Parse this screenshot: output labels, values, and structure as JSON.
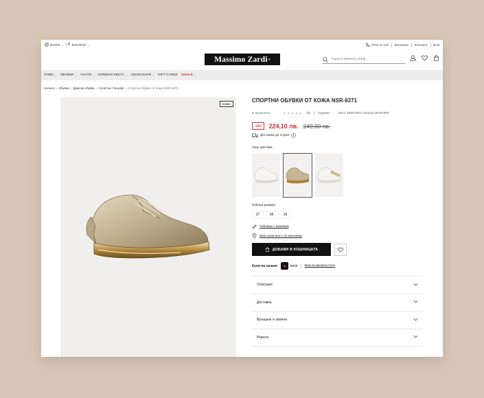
{
  "topbar": {
    "locale": "BG/EN",
    "currency": "BGN/EUR",
    "phone": "0700 11 120",
    "links": [
      "Магазини",
      "Контакти",
      "Блог"
    ]
  },
  "header": {
    "logo": "Massimo Zardi",
    "logo_mark": "®",
    "search_placeholder": "Търси в Massimo Zardi..."
  },
  "nav": [
    {
      "label": "НОВО",
      "dropdown": true
    },
    {
      "label": "ОБУВКИ",
      "dropdown": true
    },
    {
      "label": "ЧАНТИ",
      "dropdown": true
    },
    {
      "label": "КОЖЕНИ ЯКЕТА",
      "dropdown": true
    },
    {
      "label": "АКСЕСОАРИ",
      "dropdown": true
    },
    {
      "label": "GIFT CARDS",
      "dropdown": false
    },
    {
      "label": "%SALE",
      "dropdown": true
    }
  ],
  "breadcrumb": [
    "Начало",
    "Обувки",
    "Дамски обувки",
    "Спортни / Кецове",
    "Спортни обувки от кожа NSR-6371"
  ],
  "product": {
    "badge": "НОВО",
    "title": "СПОРТНИ ОБУВКИ ОТ КОЖА NSR-6371",
    "availability": "В наличност",
    "rating_count": "(0)",
    "reviews_label": "Оценки",
    "sku": "SKU: NSR-6371-GOLD-LEATHER",
    "discount": "-10%",
    "price": "224,10 лв.",
    "old_price": "249,00 лв.",
    "shipping": "Доставка до 3 дни!",
    "more_colors_label": "Още цветове:",
    "size_label": "Избери размер:",
    "sizes": [
      "37",
      "38",
      "39"
    ],
    "size_table_link": "Таблица с размери",
    "availability_link": "Виж наличност по магазини",
    "add_to_cart": "ДОБАВИ В КОШНИЦАТА",
    "leasing_label": "Купи на лизинг",
    "leasing_bank": "bank",
    "leasing_bank_mark": "tbi",
    "leasing_link": "Виж възможностите"
  },
  "accordion": [
    "Описание",
    "Доставка",
    "Връщане и замяна",
    "Ревюта"
  ],
  "colors": {
    "accent_red": "#d22b2b",
    "stock_green": "#2c8a57"
  }
}
